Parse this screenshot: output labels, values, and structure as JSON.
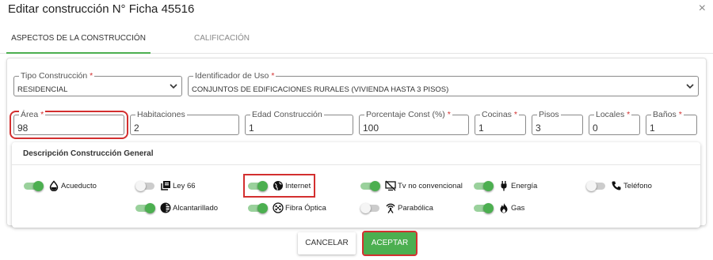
{
  "dialog": {
    "title": "Editar construcción N° Ficha 45516",
    "close_symbol": "×"
  },
  "tabs": [
    {
      "label": "ASPECTOS DE LA CONSTRUCCIÓN",
      "active": true
    },
    {
      "label": "CALIFICACIÓN",
      "active": false
    }
  ],
  "fields": {
    "tipo_construccion": {
      "label": "Tipo Construcción",
      "required": true,
      "value": "RESIDENCIAL"
    },
    "identificador_uso": {
      "label": "Identificador de Uso",
      "required": true,
      "value": "CONJUNTOS DE EDIFICACIONES RURALES (VIVIENDA HASTA 3 PISOS)"
    },
    "area": {
      "label": "Área",
      "required": true,
      "value": "98"
    },
    "habitaciones": {
      "label": "Habitaciones",
      "required": false,
      "value": "2"
    },
    "edad_construccion": {
      "label": "Edad Construcción",
      "required": false,
      "value": "1"
    },
    "porcentaje_const": {
      "label": "Porcentaje Const (%)",
      "required": true,
      "value": "100"
    },
    "cocinas": {
      "label": "Cocinas",
      "required": true,
      "value": "1"
    },
    "pisos": {
      "label": "Pisos",
      "required": false,
      "value": "3"
    },
    "locales": {
      "label": "Locales",
      "required": true,
      "value": "0"
    },
    "banos": {
      "label": "Baños",
      "required": true,
      "value": "1"
    }
  },
  "required_mark": "*",
  "description": {
    "title": "Descripción Construcción General",
    "services": [
      {
        "key": "acueducto",
        "label": "Acueducto",
        "on": true,
        "icon": "water-drop-icon"
      },
      {
        "key": "ley66",
        "label": "Ley 66",
        "on": false,
        "icon": "library-books-icon"
      },
      {
        "key": "internet",
        "label": "Internet",
        "on": true,
        "icon": "globe-icon"
      },
      {
        "key": "tv",
        "label": "Tv no convencional",
        "on": true,
        "icon": "tv-off-icon"
      },
      {
        "key": "energia",
        "label": "Energía",
        "on": true,
        "icon": "power-plug-icon"
      },
      {
        "key": "telefono",
        "label": "Teléfono",
        "on": false,
        "icon": "phone-icon"
      },
      {
        "key": "alcantarillado",
        "label": "Alcantarillado",
        "on": true,
        "icon": "sewer-icon"
      },
      {
        "key": "fibra",
        "label": "Fibra Óptica",
        "on": true,
        "icon": "fiber-optic-icon"
      },
      {
        "key": "parabolica",
        "label": "Parabólica",
        "on": false,
        "icon": "satellite-dish-icon"
      },
      {
        "key": "gas",
        "label": "Gas",
        "on": true,
        "icon": "fire-icon"
      }
    ]
  },
  "actions": {
    "cancel_label": "CANCELAR",
    "accept_label": "ACEPTAR"
  },
  "colors": {
    "accent": "#4caf50",
    "error": "#d32f2f",
    "required": "#d32f2f"
  }
}
